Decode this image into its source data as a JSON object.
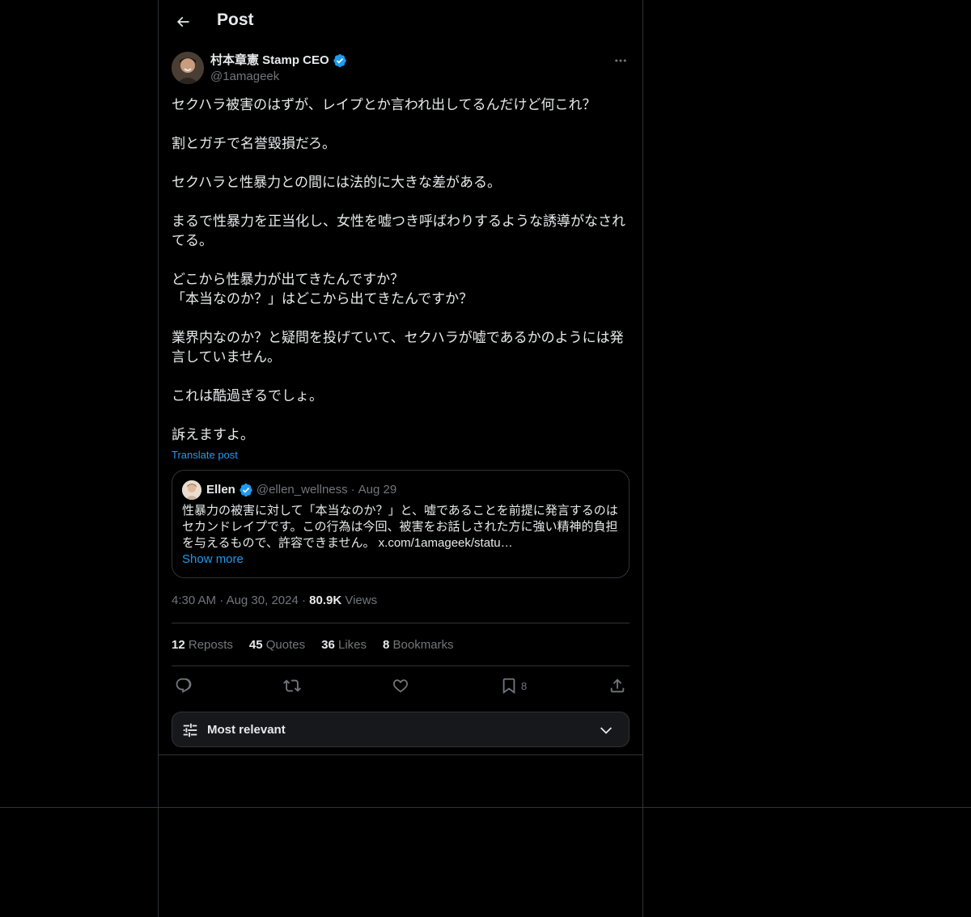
{
  "header": {
    "title": "Post"
  },
  "post": {
    "author": {
      "display_name": "村本章憲 Stamp CEO",
      "handle": "@1amageek"
    },
    "text": "セクハラ被害のはずが、レイプとか言われ出してるんだけど何これ？\n\n割とガチで名誉毀損だろ。\n\nセクハラと性暴力との間には法的に大きな差がある。\n\nまるで性暴力を正当化し、女性を嘘つき呼ばわりするような誘導がなされてる。\n\nどこから性暴力が出てきたんですか？\n「本当なのか？」はどこから出てきたんですか？\n\n業界内なのか？と疑問を投げていて、セクハラが嘘であるかのようには発言していません。\n\nこれは酷過ぎるでしょ。\n\n訴えますよ。",
    "translate_label": "Translate post",
    "quote": {
      "display_name": "Ellen",
      "handle": "@ellen_wellness",
      "separator": "·",
      "date": "Aug 29",
      "text": "性暴力の被害に対して「本当なのか？」と、嘘であることを前提に発言するのはセカンドレイプです。この行為は今回、被害をお話しされた方に強い精神的負担を与えるもので、許容できません。 x.com/1amageek/statu…",
      "show_more": "Show more"
    },
    "meta": {
      "time": "4:30 AM",
      "sep1": "·",
      "date": "Aug 30, 2024",
      "sep2": "·",
      "views_count": "80.9K",
      "views_label": "Views"
    },
    "stats": {
      "reposts_count": "12",
      "reposts_label": "Reposts",
      "quotes_count": "45",
      "quotes_label": "Quotes",
      "likes_count": "36",
      "likes_label": "Likes",
      "bookmarks_count": "8",
      "bookmarks_label": "Bookmarks"
    },
    "actions": {
      "bookmark_count": "8"
    }
  },
  "sort": {
    "label": "Most relevant"
  },
  "icons": {
    "back": "arrow-left-icon",
    "verified": "verified-badge-icon",
    "more": "more-horizontal-icon",
    "reply": "reply-icon",
    "repost": "repost-icon",
    "like": "heart-icon",
    "bookmark": "bookmark-icon",
    "share": "share-icon",
    "sort": "sliders-icon",
    "chevron": "chevron-down-icon"
  },
  "colors": {
    "background": "#000000",
    "text": "#e7e9ea",
    "muted": "#71767b",
    "accent": "#1d9bf0",
    "border": "#2f3336",
    "sort_bar_bg": "#16181c"
  }
}
